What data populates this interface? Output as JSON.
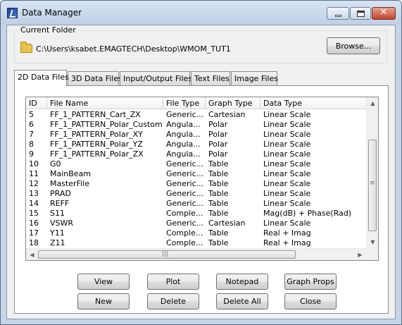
{
  "window": {
    "title": "Data Manager",
    "close_glyph": "✕"
  },
  "folder": {
    "legend": "Current Folder",
    "path": "C:\\Users\\ksabet.EMAGTECH\\Desktop\\WMOM_TUT1",
    "browse_label": "Browse..."
  },
  "tabs": [
    {
      "label": "2D Data Files",
      "active": true
    },
    {
      "label": "3D Data Files",
      "active": false
    },
    {
      "label": "Input/Output Files",
      "active": false
    },
    {
      "label": "Text Files",
      "active": false
    },
    {
      "label": "Image Files",
      "active": false
    }
  ],
  "table": {
    "columns": [
      "ID",
      "File Name",
      "File Type",
      "Graph Type",
      "Data Type"
    ],
    "rows": [
      [
        "5",
        "FF_1_PATTERN_Cart_ZX",
        "Generic...",
        "Cartesian",
        "Linear Scale"
      ],
      [
        "6",
        "FF_1_PATTERN_Polar_Custom",
        "Angula...",
        "Polar",
        "Linear Scale"
      ],
      [
        "7",
        "FF_1_PATTERN_Polar_XY",
        "Angula...",
        "Polar",
        "Linear Scale"
      ],
      [
        "8",
        "FF_1_PATTERN_Polar_YZ",
        "Angula...",
        "Polar",
        "Linear Scale"
      ],
      [
        "9",
        "FF_1_PATTERN_Polar_ZX",
        "Angula...",
        "Polar",
        "Linear Scale"
      ],
      [
        "10",
        "G0",
        "Generic...",
        "Table",
        "Linear Scale"
      ],
      [
        "11",
        "MainBeam",
        "Generic...",
        "Table",
        "Linear Scale"
      ],
      [
        "12",
        "MasterFile",
        "Generic...",
        "Table",
        "Linear Scale"
      ],
      [
        "13",
        "PRAD",
        "Generic...",
        "Table",
        "Linear Scale"
      ],
      [
        "14",
        "REFF",
        "Generic...",
        "Table",
        "Linear Scale"
      ],
      [
        "15",
        "S11",
        "Comple...",
        "Table",
        "Mag(dB) + Phase(Rad)"
      ],
      [
        "16",
        "VSWR",
        "Generic...",
        "Cartesian",
        "Linear Scale"
      ],
      [
        "17",
        "Y11",
        "Comple...",
        "Table",
        "Real + Imag"
      ],
      [
        "18",
        "Z11",
        "Comple...",
        "Table",
        "Real + Imag"
      ]
    ]
  },
  "scroll": {
    "up": "▲",
    "down": "▼",
    "left": "◀",
    "right": "▶",
    "vgrip": "≡",
    "hgrip": "|||"
  },
  "buttons": {
    "view": "View",
    "plot": "Plot",
    "notepad": "Notepad",
    "graph_props": "Graph Props",
    "new": "New",
    "delete": "Delete",
    "delete_all": "Delete All",
    "close": "Close"
  }
}
